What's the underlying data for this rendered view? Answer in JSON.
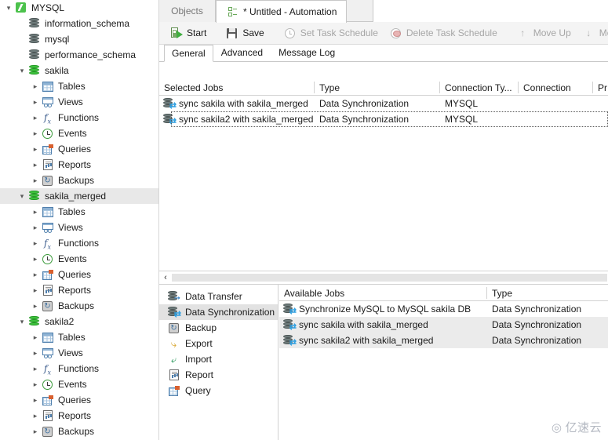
{
  "sidebar": {
    "items": [
      {
        "label": "MYSQL",
        "depth": 0,
        "chevron": "down",
        "icon": "connection-icon",
        "selected": false
      },
      {
        "label": "information_schema",
        "depth": 1,
        "chevron": "none",
        "icon": "database-gray-icon",
        "selected": false
      },
      {
        "label": "mysql",
        "depth": 1,
        "chevron": "none",
        "icon": "database-gray-icon",
        "selected": false
      },
      {
        "label": "performance_schema",
        "depth": 1,
        "chevron": "none",
        "icon": "database-gray-icon",
        "selected": false
      },
      {
        "label": "sakila",
        "depth": 1,
        "chevron": "down",
        "icon": "database-green-icon",
        "selected": false
      },
      {
        "label": "Tables",
        "depth": 2,
        "chevron": "right",
        "icon": "tables-icon",
        "selected": false
      },
      {
        "label": "Views",
        "depth": 2,
        "chevron": "right",
        "icon": "views-icon",
        "selected": false
      },
      {
        "label": "Functions",
        "depth": 2,
        "chevron": "right",
        "icon": "functions-icon",
        "selected": false
      },
      {
        "label": "Events",
        "depth": 2,
        "chevron": "right",
        "icon": "events-icon",
        "selected": false
      },
      {
        "label": "Queries",
        "depth": 2,
        "chevron": "right",
        "icon": "queries-icon",
        "selected": false
      },
      {
        "label": "Reports",
        "depth": 2,
        "chevron": "right",
        "icon": "reports-icon",
        "selected": false
      },
      {
        "label": "Backups",
        "depth": 2,
        "chevron": "right",
        "icon": "backups-icon",
        "selected": false
      },
      {
        "label": "sakila_merged",
        "depth": 1,
        "chevron": "down",
        "icon": "database-green-icon",
        "selected": true
      },
      {
        "label": "Tables",
        "depth": 2,
        "chevron": "right",
        "icon": "tables-icon",
        "selected": false
      },
      {
        "label": "Views",
        "depth": 2,
        "chevron": "right",
        "icon": "views-icon",
        "selected": false
      },
      {
        "label": "Functions",
        "depth": 2,
        "chevron": "right",
        "icon": "functions-icon",
        "selected": false
      },
      {
        "label": "Events",
        "depth": 2,
        "chevron": "right",
        "icon": "events-icon",
        "selected": false
      },
      {
        "label": "Queries",
        "depth": 2,
        "chevron": "right",
        "icon": "queries-icon",
        "selected": false
      },
      {
        "label": "Reports",
        "depth": 2,
        "chevron": "right",
        "icon": "reports-icon",
        "selected": false
      },
      {
        "label": "Backups",
        "depth": 2,
        "chevron": "right",
        "icon": "backups-icon",
        "selected": false
      },
      {
        "label": "sakila2",
        "depth": 1,
        "chevron": "down",
        "icon": "database-green-icon",
        "selected": false
      },
      {
        "label": "Tables",
        "depth": 2,
        "chevron": "right",
        "icon": "tables-icon",
        "selected": false
      },
      {
        "label": "Views",
        "depth": 2,
        "chevron": "right",
        "icon": "views-icon",
        "selected": false
      },
      {
        "label": "Functions",
        "depth": 2,
        "chevron": "right",
        "icon": "functions-icon",
        "selected": false
      },
      {
        "label": "Events",
        "depth": 2,
        "chevron": "right",
        "icon": "events-icon",
        "selected": false
      },
      {
        "label": "Queries",
        "depth": 2,
        "chevron": "right",
        "icon": "queries-icon",
        "selected": false
      },
      {
        "label": "Reports",
        "depth": 2,
        "chevron": "right",
        "icon": "reports-icon",
        "selected": false
      },
      {
        "label": "Backups",
        "depth": 2,
        "chevron": "right",
        "icon": "backups-icon",
        "selected": false
      }
    ]
  },
  "tabs": [
    {
      "label": "Objects",
      "active": false,
      "icon": null
    },
    {
      "label": "* Untitled - Automation",
      "active": true,
      "icon": "automation-icon"
    }
  ],
  "toolbar": {
    "buttons": [
      {
        "label": "Start",
        "icon": "start-icon",
        "disabled": false
      },
      {
        "label": "Save",
        "icon": "save-icon",
        "disabled": false
      },
      {
        "label": "Set Task Schedule",
        "icon": "set-task-schedule-icon",
        "disabled": true
      },
      {
        "label": "Delete Task Schedule",
        "icon": "delete-task-schedule-icon",
        "disabled": true
      },
      {
        "label": "Move Up",
        "icon": "arrow-up-icon",
        "disabled": true
      },
      {
        "label": "Move Down",
        "icon": "arrow-down-icon",
        "disabled": true
      }
    ]
  },
  "subtabs": [
    {
      "label": "General",
      "active": true
    },
    {
      "label": "Advanced",
      "active": false
    },
    {
      "label": "Message Log",
      "active": false
    }
  ],
  "selected_jobs": {
    "columns": [
      "Selected Jobs",
      "Type",
      "Connection Ty...",
      "Connection",
      "Pr"
    ],
    "rows": [
      {
        "name": "sync sakila with sakila_merged",
        "type": "Data Synchronization",
        "connection_type": "MYSQL",
        "connection": "",
        "pr": "",
        "focused": false
      },
      {
        "name": "sync sakila2 with sakila_merged",
        "type": "Data Synchronization",
        "connection_type": "MYSQL",
        "connection": "",
        "pr": "",
        "focused": true
      }
    ]
  },
  "categories": [
    {
      "label": "Data Transfer",
      "icon": "data-transfer-icon",
      "selected": false
    },
    {
      "label": "Data Synchronization",
      "icon": "data-synchronization-icon",
      "selected": true
    },
    {
      "label": "Backup",
      "icon": "backup-icon",
      "selected": false
    },
    {
      "label": "Export",
      "icon": "export-icon",
      "selected": false
    },
    {
      "label": "Import",
      "icon": "import-icon",
      "selected": false
    },
    {
      "label": "Report",
      "icon": "report-icon",
      "selected": false
    },
    {
      "label": "Query",
      "icon": "query-icon",
      "selected": false
    }
  ],
  "available_jobs": {
    "columns": [
      "Available Jobs",
      "Type"
    ],
    "rows": [
      {
        "name": "Synchronize MySQL to MySQL sakila DB",
        "type": "Data Synchronization",
        "selected": false
      },
      {
        "name": "sync sakila with sakila_merged",
        "type": "Data Synchronization",
        "selected": true
      },
      {
        "name": "sync sakila2 with sakila_merged",
        "type": "Data Synchronization",
        "selected": true
      }
    ]
  },
  "splitter": {
    "collapse_label": "‹"
  },
  "watermark": {
    "glyph": "◎",
    "text": "亿速云"
  },
  "colors": {
    "accent_green": "#3ec13e",
    "selection_gray": "#e8e8e8",
    "row_selection": "#ebebeb",
    "toolbar_bg": "#f4f4f4",
    "tabbar_bg": "#f0f0f0",
    "border": "#d2d2d2",
    "disabled_text": "#a6a6a6"
  }
}
